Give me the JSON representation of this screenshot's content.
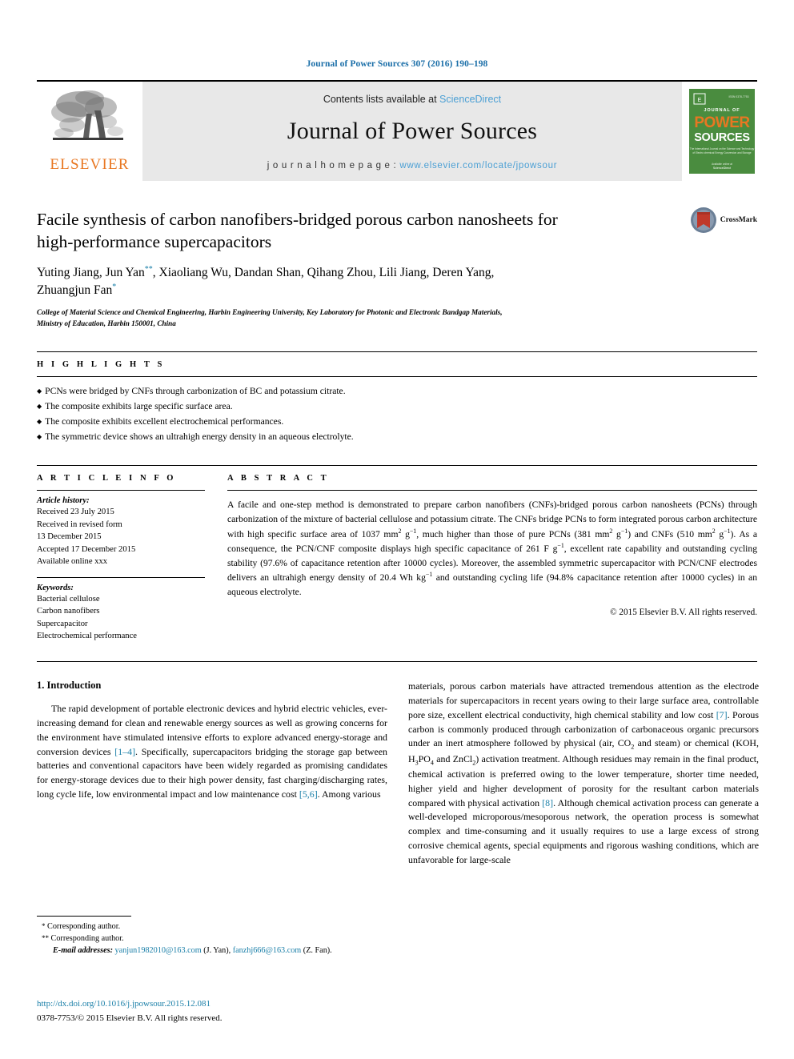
{
  "running_head": "Journal of Power Sources 307 (2016) 190–198",
  "masthead": {
    "contents_prefix": "Contents lists available at ",
    "sciencedirect": "ScienceDirect",
    "journal_name": "Journal of Power Sources",
    "homepage_prefix": "j o u r n a l   h o m e p a g e :  ",
    "homepage_url": "www.elsevier.com/locate/jpowsour",
    "publisher_wordmark": "ELSEVIER",
    "cover": {
      "line1": "JOURNAL OF",
      "line2": "POWER",
      "line3": "SOURCES",
      "bg_color": "#4a8c3f",
      "accent_color": "#e87722"
    }
  },
  "article": {
    "title": "Facile synthesis of carbon nanofibers-bridged porous carbon nanosheets for high-performance supercapacitors",
    "authors_line1": "Yuting Jiang, Jun Yan",
    "authors_marker1": "**",
    "authors_line1b": ", Xiaoliang Wu, Dandan Shan, Qihang Zhou, Lili Jiang, Deren Yang,",
    "authors_line2": "Zhuangjun Fan",
    "authors_marker2": "*",
    "affiliation_line1": "College of Material Science and Chemical Engineering, Harbin Engineering University, Key Laboratory for Photonic and Electronic Bandgap Materials,",
    "affiliation_line2": "Ministry of Education, Harbin 150001, China",
    "crossmark_label": "CrossMark"
  },
  "highlights": {
    "heading": "H I G H L I G H T S",
    "items": [
      "PCNs were bridged by CNFs through carbonization of BC and potassium citrate.",
      "The composite exhibits large specific surface area.",
      "The composite exhibits excellent electrochemical performances.",
      "The symmetric device shows an ultrahigh energy density in an aqueous electrolyte."
    ]
  },
  "article_info": {
    "heading": "A R T I C L E   I N F O",
    "history_label": "Article history:",
    "history_lines": [
      "Received 23 July 2015",
      "Received in revised form",
      "13 December 2015",
      "Accepted 17 December 2015",
      "Available online xxx"
    ],
    "keywords_label": "Keywords:",
    "keywords": [
      "Bacterial cellulose",
      "Carbon nanofibers",
      "Supercapacitor",
      "Electrochemical performance"
    ]
  },
  "abstract": {
    "heading": "A B S T R A C T",
    "paragraph_parts": {
      "p1": "A facile and one-step method is demonstrated to prepare carbon nanofibers (CNFs)-bridged porous carbon nanosheets (PCNs) through carbonization of the mixture of bacterial cellulose and potassium citrate. The CNFs bridge PCNs to form integrated porous carbon architecture with high specific surface area of 1037 m",
      "p2": ", much higher than those of pure PCNs (381 m",
      "p3": ") and CNFs (510 m",
      "p4": "). As a consequence, the PCN/CNF composite displays high specific capacitance of 261 F g",
      "p5": ", excellent rate capability and outstanding cycling stability (97.6% of capacitance retention after 10000 cycles). Moreover, the assembled symmetric supercapacitor with PCN/CNF electrodes delivers an ultrahigh energy density of 20.4 Wh kg",
      "p6": " and outstanding cycling life (94.8% capacitance retention after 10000 cycles) in an aqueous electrolyte."
    },
    "units": {
      "sup2": "2",
      "supneg1": "−1",
      "g": "g",
      "m": "m"
    },
    "copyright": "© 2015 Elsevier B.V. All rights reserved."
  },
  "body": {
    "section_number_title": "1. Introduction",
    "left_col": {
      "t1": "The rapid development of portable electronic devices and hybrid electric vehicles, ever-increasing demand for clean and renewable energy sources as well as growing concerns for the environment have stimulated intensive efforts to explore advanced energy-storage and conversion devices ",
      "ref1": "[1–4]",
      "t2": ". Specifically, supercapacitors bridging the storage gap between batteries and conventional capacitors have been widely regarded as promising candidates for energy-storage devices due to their high power density, fast charging/discharging rates, long cycle life, low environmental impact and low maintenance cost ",
      "ref2": "[5,6]",
      "t3": ". Among various"
    },
    "right_col": {
      "t1": "materials, porous carbon materials have attracted tremendous attention as the electrode materials for supercapacitors in recent years owing to their large surface area, controllable pore size, excellent electrical conductivity, high chemical stability and low cost ",
      "ref1": "[7]",
      "t2": ". Porous carbon is commonly produced through carbonization of carbonaceous organic precursors under an inert atmosphere followed by physical (air, CO",
      "sub2a": "2",
      "t3": " and steam) or chemical (KOH, H",
      "sub3": "3",
      "t4": "PO",
      "sub4": "4",
      "t5": " and ZnCl",
      "sub2b": "2",
      "t6": ") activation treatment. Although residues may remain in the final product, chemical activation is preferred owing to the lower temperature, shorter time needed, higher yield and higher development of porosity for the resultant carbon materials compared with physical activation ",
      "ref2": "[8]",
      "t7": ". Although chemical activation process can generate a well-developed microporous/mesoporous network, the operation process is somewhat complex and time-consuming and it usually requires to use a large excess of strong corrosive chemical agents, special equipments and rigorous washing conditions, which are unfavorable for large-scale"
    }
  },
  "footnotes": {
    "mark1": "*",
    "note1": "Corresponding author.",
    "mark2": "**",
    "note2": "Corresponding author.",
    "emails_label": "E-mail addresses:",
    "email1": "yanjun1982010@163.com",
    "email1_attr": " (J. Yan), ",
    "email2": "fanzhj666@163.com",
    "email2_attr": " (Z. Fan)."
  },
  "doi_block": {
    "doi_url": "http://dx.doi.org/10.1016/j.jpowsour.2015.12.081",
    "issn_line": "0378-7753/© 2015 Elsevier B.V. All rights reserved."
  },
  "colors": {
    "link": "#1a7fa8",
    "header_blue": "#1a6ea8",
    "elsevier_orange": "#E87722",
    "masthead_gray": "#e8e8e8",
    "cover_green": "#4a8c3f"
  }
}
